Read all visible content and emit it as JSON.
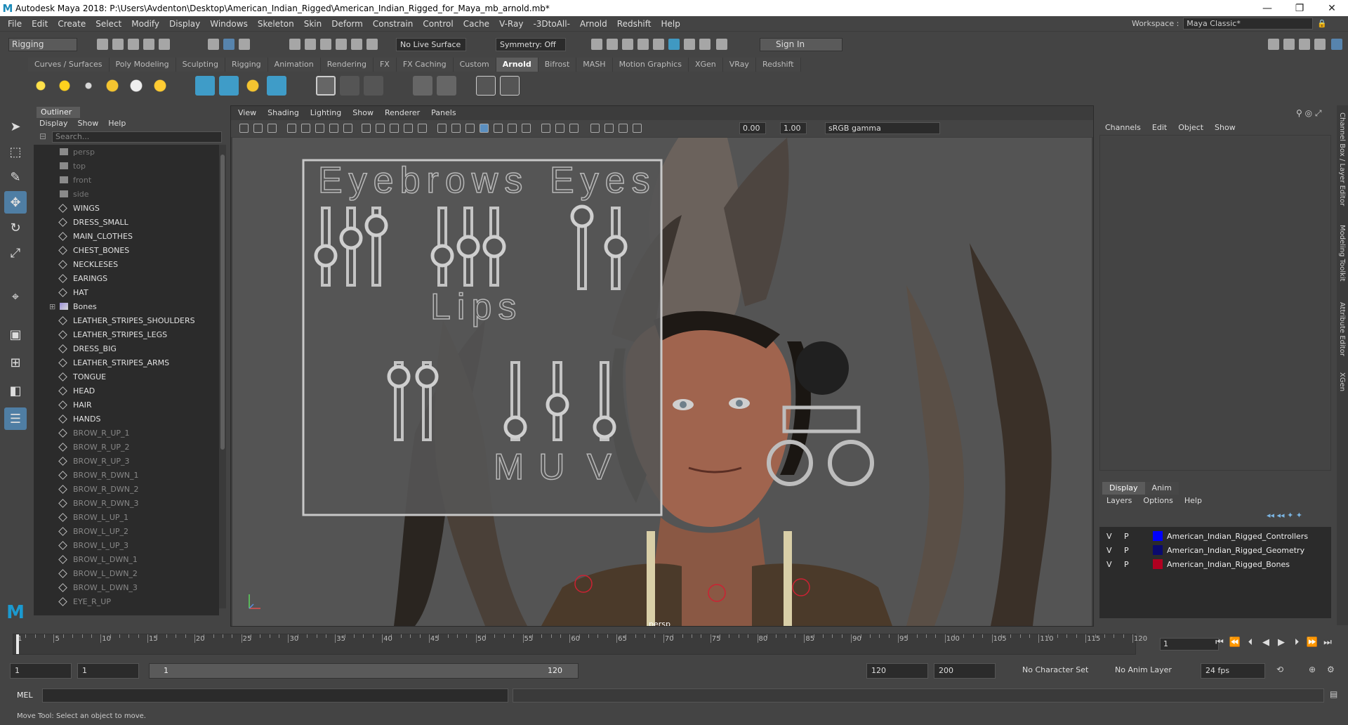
{
  "window": {
    "title": "Autodesk Maya 2018: P:\\Users\\Avdenton\\Desktop\\American_Indian_Rigged\\American_Indian_Rigged_for_Maya_mb_arnold.mb*",
    "minimize": "—",
    "maximize": "❐",
    "close": "✕"
  },
  "menubar": {
    "items": [
      "File",
      "Edit",
      "Create",
      "Select",
      "Modify",
      "Display",
      "Windows",
      "Skeleton",
      "Skin",
      "Deform",
      "Constrain",
      "Control",
      "Cache",
      "V-Ray",
      "-3DtoAll-",
      "Arnold",
      "Redshift",
      "Help"
    ],
    "workspace_label": "Workspace :",
    "workspace_value": "Maya Classic*"
  },
  "statusline": {
    "mode": "Rigging",
    "live_surface": "No Live Surface",
    "symmetry": "Symmetry: Off",
    "sign_in": "Sign In"
  },
  "shelf": {
    "tabs": [
      "Curves / Surfaces",
      "Poly Modeling",
      "Sculpting",
      "Rigging",
      "Animation",
      "Rendering",
      "FX",
      "FX Caching",
      "Custom",
      "Arnold",
      "Bifrost",
      "MASH",
      "Motion Graphics",
      "XGen",
      "VRay",
      "Redshift"
    ],
    "active_tab": "Arnold"
  },
  "outliner": {
    "tab": "Outliner",
    "menu": [
      "Display",
      "Show",
      "Help"
    ],
    "search_placeholder": "Search...",
    "items": [
      {
        "label": "persp",
        "kind": "cam"
      },
      {
        "label": "top",
        "kind": "cam"
      },
      {
        "label": "front",
        "kind": "cam"
      },
      {
        "label": "side",
        "kind": "cam"
      },
      {
        "label": "WINGS",
        "kind": "grp"
      },
      {
        "label": "DRESS_SMALL",
        "kind": "grp"
      },
      {
        "label": "MAIN_CLOTHES",
        "kind": "grp"
      },
      {
        "label": "CHEST_BONES",
        "kind": "grp"
      },
      {
        "label": "NECKLESES",
        "kind": "grp"
      },
      {
        "label": "EARINGS",
        "kind": "grp"
      },
      {
        "label": "HAT",
        "kind": "grp"
      },
      {
        "label": "Bones",
        "kind": "joint"
      },
      {
        "label": "LEATHER_STRIPES_SHOULDERS",
        "kind": "grp"
      },
      {
        "label": "LEATHER_STRIPES_LEGS",
        "kind": "grp"
      },
      {
        "label": "DRESS_BIG",
        "kind": "grp"
      },
      {
        "label": "LEATHER_STRIPES_ARMS",
        "kind": "grp"
      },
      {
        "label": "TONGUE",
        "kind": "grp"
      },
      {
        "label": "HEAD",
        "kind": "grp"
      },
      {
        "label": "HAIR",
        "kind": "grp"
      },
      {
        "label": "HANDS",
        "kind": "grp"
      },
      {
        "label": "BROW_R_UP_1",
        "kind": "dim"
      },
      {
        "label": "BROW_R_UP_2",
        "kind": "dim"
      },
      {
        "label": "BROW_R_UP_3",
        "kind": "dim"
      },
      {
        "label": "BROW_R_DWN_1",
        "kind": "dim"
      },
      {
        "label": "BROW_R_DWN_2",
        "kind": "dim"
      },
      {
        "label": "BROW_R_DWN_3",
        "kind": "dim"
      },
      {
        "label": "BROW_L_UP_1",
        "kind": "dim"
      },
      {
        "label": "BROW_L_UP_2",
        "kind": "dim"
      },
      {
        "label": "BROW_L_UP_3",
        "kind": "dim"
      },
      {
        "label": "BROW_L_DWN_1",
        "kind": "dim"
      },
      {
        "label": "BROW_L_DWN_2",
        "kind": "dim"
      },
      {
        "label": "BROW_L_DWN_3",
        "kind": "dim"
      },
      {
        "label": "EYE_R_UP",
        "kind": "dim"
      }
    ]
  },
  "viewport": {
    "menu": [
      "View",
      "Shading",
      "Lighting",
      "Show",
      "Renderer",
      "Panels"
    ],
    "near_value": "0.00",
    "far_value": "1.00",
    "color_space": "sRGB gamma",
    "camera_label": "persp",
    "rig_labels": {
      "eyebrows": "Eyebrows",
      "eyes": "Eyes",
      "lips": "Lips",
      "m": "M",
      "u": "U",
      "v": "V"
    }
  },
  "channelbox": {
    "menu": [
      "Channels",
      "Edit",
      "Object",
      "Show"
    ],
    "layer_tabs": [
      "Display",
      "Anim"
    ],
    "layer_menu": [
      "Layers",
      "Options",
      "Help"
    ],
    "layers": [
      {
        "v": "V",
        "p": "P",
        "name": "American_Indian_Rigged_Controllers",
        "color": "#0000ff"
      },
      {
        "v": "V",
        "p": "P",
        "name": "American_Indian_Rigged_Geometry",
        "color": "#0a0a6e"
      },
      {
        "v": "V",
        "p": "P",
        "name": "American_Indian_Rigged_Bones",
        "color": "#b00020"
      }
    ]
  },
  "side_tabs": [
    "Channel Box / Layer Editor",
    "Modeling Toolkit",
    "Attribute Editor",
    "XGen"
  ],
  "timeslider": {
    "ticks": [
      "1",
      "5",
      "10",
      "15",
      "20",
      "25",
      "30",
      "35",
      "40",
      "45",
      "50",
      "55",
      "60",
      "65",
      "70",
      "75",
      "80",
      "85",
      "90",
      "95",
      "100",
      "105",
      "110",
      "115",
      "120"
    ],
    "current_frame": "1"
  },
  "rangeslider": {
    "start": "1",
    "playback_start": "1",
    "bar_start": "1",
    "bar_end": "120",
    "playback_end": "120",
    "end": "200",
    "character_set": "No Character Set",
    "anim_layer": "No Anim Layer",
    "fps": "24 fps"
  },
  "cmdline": {
    "label": "MEL"
  },
  "helpline": {
    "text": "Move Tool: Select an object to move."
  }
}
